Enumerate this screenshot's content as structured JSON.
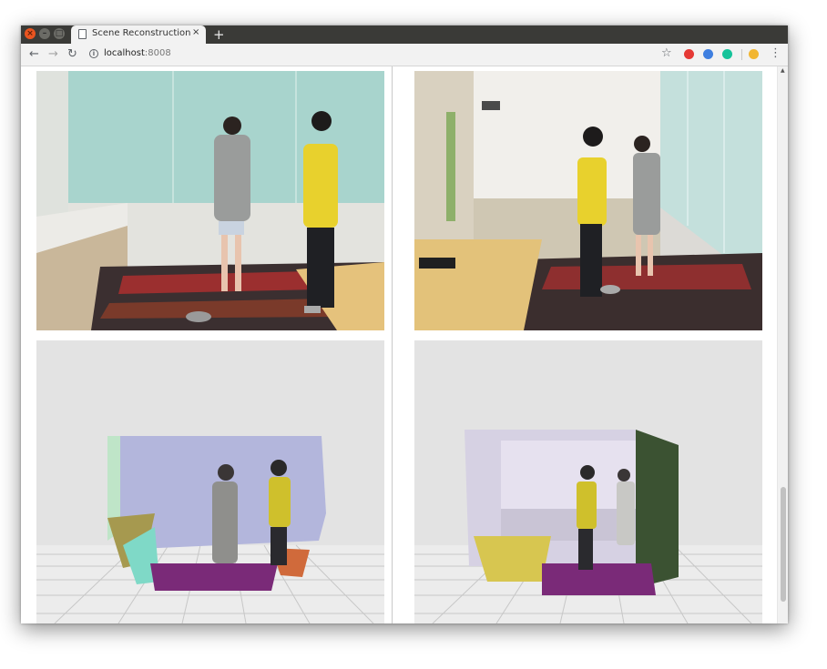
{
  "browser": {
    "tab_title": "Scene Reconstruction fro",
    "tab_close": "×",
    "new_tab": "+",
    "url_host": "localhost",
    "url_port": ":8008",
    "nav": {
      "back": "←",
      "forward": "→",
      "reload": "↻"
    },
    "star": "☆",
    "menu": "⋮"
  },
  "extensions": [
    {
      "name": "adblock-icon",
      "color": "#e53935"
    },
    {
      "name": "extension-blue-icon",
      "color": "#3f7fe0"
    },
    {
      "name": "grammarly-icon",
      "color": "#15c39a"
    },
    {
      "name": "extension-yellow-icon",
      "color": "#f2b632"
    }
  ],
  "content": {
    "panels": [
      {
        "name": "photo-room-left",
        "kind": "photo"
      },
      {
        "name": "photo-room-right",
        "kind": "photo"
      },
      {
        "name": "reconstruction-3d-left",
        "kind": "render"
      },
      {
        "name": "reconstruction-3d-right",
        "kind": "render"
      }
    ]
  }
}
